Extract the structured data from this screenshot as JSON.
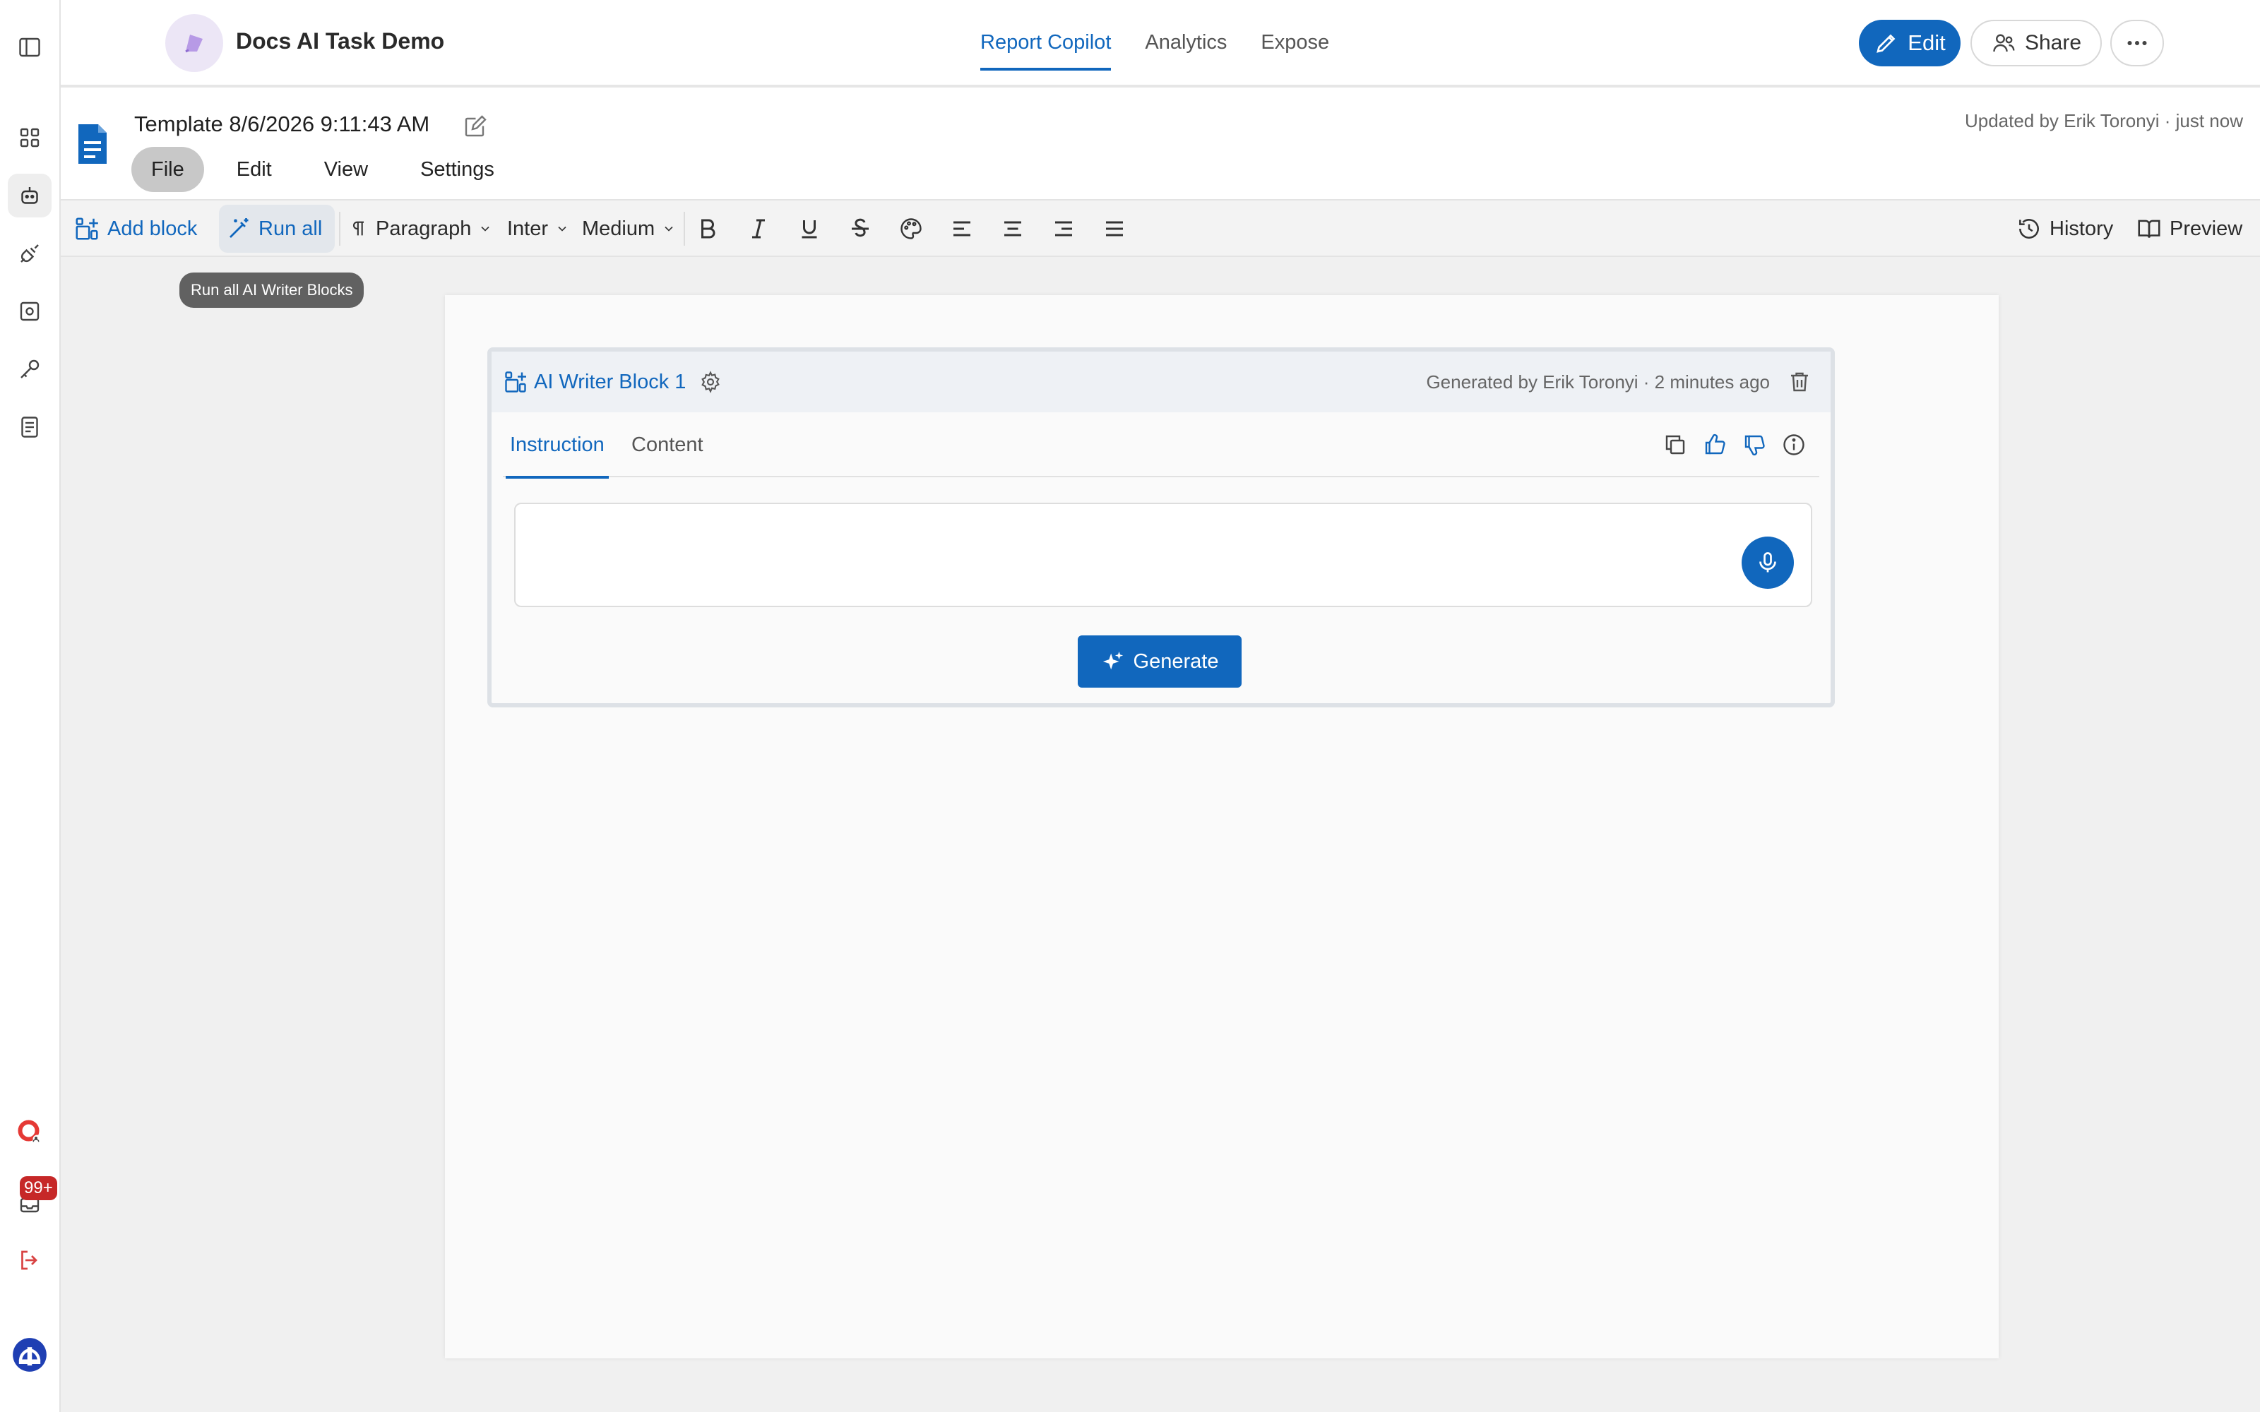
{
  "app": {
    "title": "Docs AI Task Demo",
    "nav_tabs": [
      {
        "label": "Report Copilot",
        "active": true
      },
      {
        "label": "Analytics",
        "active": false
      },
      {
        "label": "Expose",
        "active": false
      }
    ],
    "edit_label": "Edit",
    "share_label": "Share"
  },
  "rail": {
    "icons": [
      "sidebar-toggle-icon",
      "dashboard-icon",
      "robot-icon",
      "plug-icon",
      "scan-icon",
      "key-icon",
      "notebook-icon",
      "support-icon",
      "inbox-icon",
      "logout-icon",
      "user-avatar"
    ],
    "inbox_badge": "99+"
  },
  "document": {
    "title": "Template 8/6/2026 9:11:43 AM",
    "updated": "Updated by Erik Toronyi · just now",
    "menu": [
      "File",
      "Edit",
      "View",
      "Settings"
    ],
    "active_menu": "File"
  },
  "toolbar": {
    "add_block": "Add block",
    "run_all": "Run all",
    "paragraph": "Paragraph",
    "font": "Inter",
    "weight": "Medium",
    "history": "History",
    "preview": "Preview"
  },
  "tooltip": "Run all AI Writer Blocks",
  "block": {
    "title": "AI Writer Block 1",
    "meta": "Generated by Erik Toronyi · 2 minutes ago",
    "tabs": [
      "Instruction",
      "Content"
    ],
    "active_tab": "Instruction",
    "instruction_value": "",
    "generate_label": "Generate"
  },
  "colors": {
    "accent": "#1167bd",
    "badge": "#c62828",
    "logo_bg": "#ece6f6"
  }
}
